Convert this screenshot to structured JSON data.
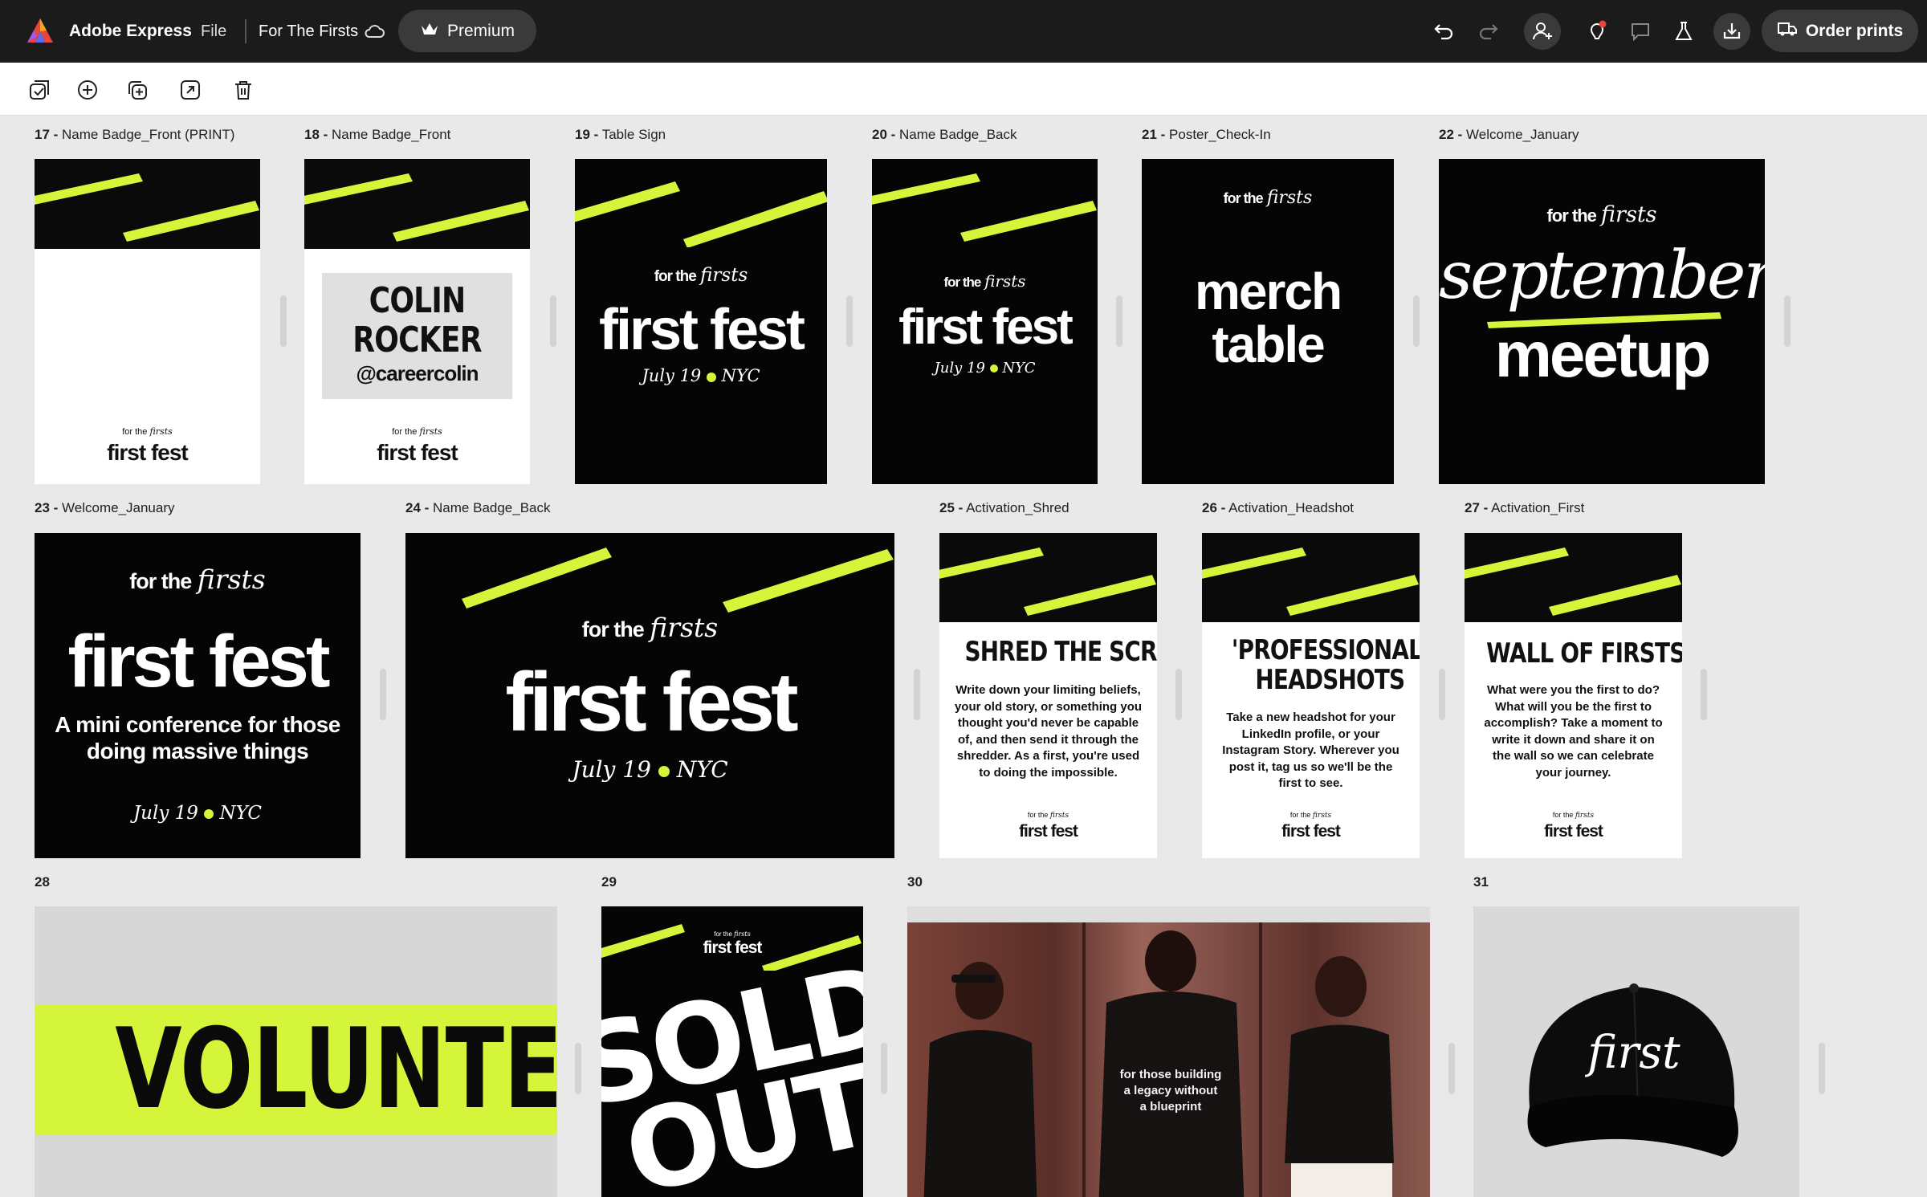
{
  "app": {
    "name": "Adobe Express",
    "file_menu": "File",
    "document_title": "For The Firsts",
    "premium_label": "Premium",
    "order_prints_label": "Order prints"
  },
  "toolbar": {
    "tools": [
      "select-all-icon",
      "add-page-icon",
      "duplicate-page-icon",
      "resize-icon",
      "delete-icon"
    ]
  },
  "colors": {
    "accent": "#d5f53a",
    "topbar": "#1b1b1b",
    "canvas": "#e9e9e9"
  },
  "pages": {
    "p17": {
      "num": "17 -",
      "name": "Name Badge_Front (PRINT)",
      "brand_small": "for the",
      "brand_script": "firsts",
      "event": "first fest"
    },
    "p18": {
      "num": "18 -",
      "name": "Name Badge_Front",
      "person": "COLIN ROCKER",
      "handle": "@careercolin",
      "brand_small": "for the",
      "brand_script": "firsts",
      "event": "first fest"
    },
    "p19": {
      "num": "19 -",
      "name": "Table Sign",
      "brand_small": "for the",
      "brand_script": "firsts",
      "event": "first fest",
      "date": "July 19",
      "city": "NYC"
    },
    "p20": {
      "num": "20 -",
      "name": "Name Badge_Back",
      "brand_small": "for the",
      "brand_script": "firsts",
      "event": "first fest",
      "date": "July 19",
      "city": "NYC"
    },
    "p21": {
      "num": "21 -",
      "name": "Poster_Check-In",
      "brand_small": "for the",
      "brand_script": "firsts",
      "headline": "merch table"
    },
    "p22": {
      "num": "22 -",
      "name": "Welcome_January",
      "brand_small": "for the",
      "brand_script": "firsts",
      "script_word": "september",
      "headline": "meetup"
    },
    "p23": {
      "num": "23 -",
      "name": "Welcome_January",
      "brand_small": "for the",
      "brand_script": "firsts",
      "event": "first fest",
      "tagline": "A mini conference for those doing massive things",
      "date": "July 19",
      "city": "NYC"
    },
    "p24": {
      "num": "24 -",
      "name": "Name Badge_Back",
      "brand_small": "for the",
      "brand_script": "firsts",
      "event": "first fest",
      "date": "July 19",
      "city": "NYC"
    },
    "p25": {
      "num": "25 -",
      "name": "Activation_Shred",
      "title": "SHRED THE SCRIPT",
      "body": "Write down your limiting beliefs, your old story, or something you thought you'd never be capable of, and then send it through the shredder. As a first, you're used to doing the impossible.",
      "brand_small": "for the",
      "brand_script": "firsts",
      "event": "first fest"
    },
    "p26": {
      "num": "26 -",
      "name": "Activation_Headshot",
      "title": "'PROFESSIONAL' HEADSHOTS",
      "body": "Take a new headshot for your LinkedIn profile, or your Instagram Story. Wherever you post it, tag us so we'll be the first to see.",
      "brand_small": "for the",
      "brand_script": "firsts",
      "event": "first fest"
    },
    "p27": {
      "num": "27 -",
      "name": "Activation_First",
      "title": "WALL OF FIRSTS",
      "body": "What were you the first to do? What will you be the first to accomplish? Take a moment to write it down and share it on the wall so we can celebrate your journey.",
      "brand_small": "for the",
      "brand_script": "firsts",
      "event": "first fest"
    },
    "p28": {
      "num": "28",
      "headline": "VOLUNTEER"
    },
    "p29": {
      "num": "29",
      "brand_small": "for the",
      "brand_script": "firsts",
      "event": "first fest",
      "headline1": "SOLD",
      "headline2": "OUT"
    },
    "p30": {
      "num": "30",
      "shirt_text": "for those building a legacy without a blueprint"
    },
    "p31": {
      "num": "31",
      "cap_text": "first"
    }
  }
}
